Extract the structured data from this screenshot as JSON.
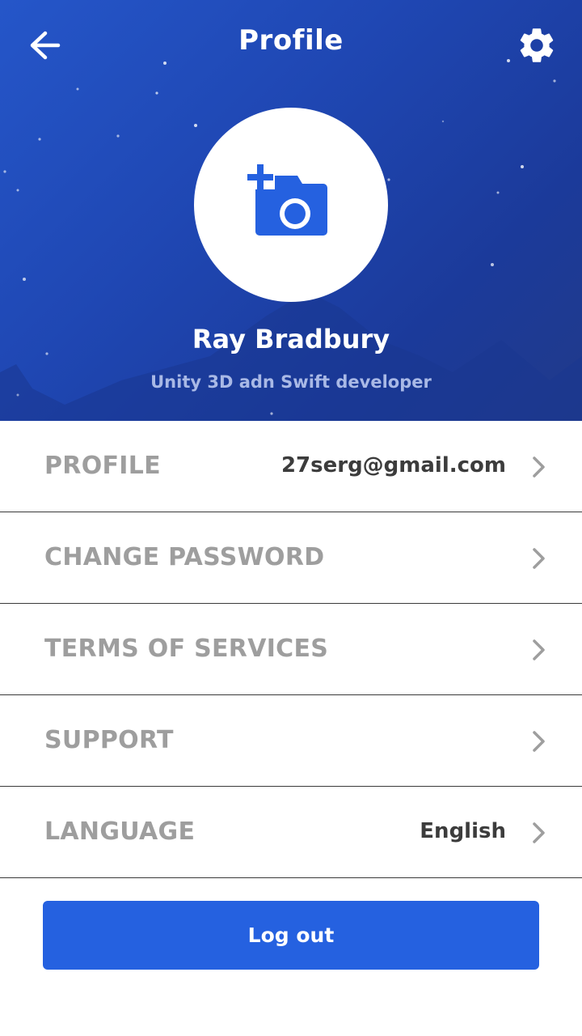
{
  "header": {
    "title": "Profile",
    "back_icon": "arrow-left-icon",
    "settings_icon": "gear-icon"
  },
  "profile": {
    "avatar_icon": "add-photo-icon",
    "name": "Ray Bradbury",
    "role": "Unity 3D adn Swift developer"
  },
  "menu": {
    "items": [
      {
        "label": "PROFILE",
        "value": "27serg@gmail.com"
      },
      {
        "label": "CHANGE PASSWORD",
        "value": ""
      },
      {
        "label": "TERMS OF SERVICES",
        "value": ""
      },
      {
        "label": "SUPPORT",
        "value": ""
      },
      {
        "label": "LANGUAGE",
        "value": "English"
      }
    ]
  },
  "logout": {
    "label": "Log out"
  },
  "colors": {
    "accent": "#2561e0",
    "header_bg": "#1f47b3",
    "label_gray": "#9e9e9e",
    "value_dark": "#3c3c3c"
  }
}
